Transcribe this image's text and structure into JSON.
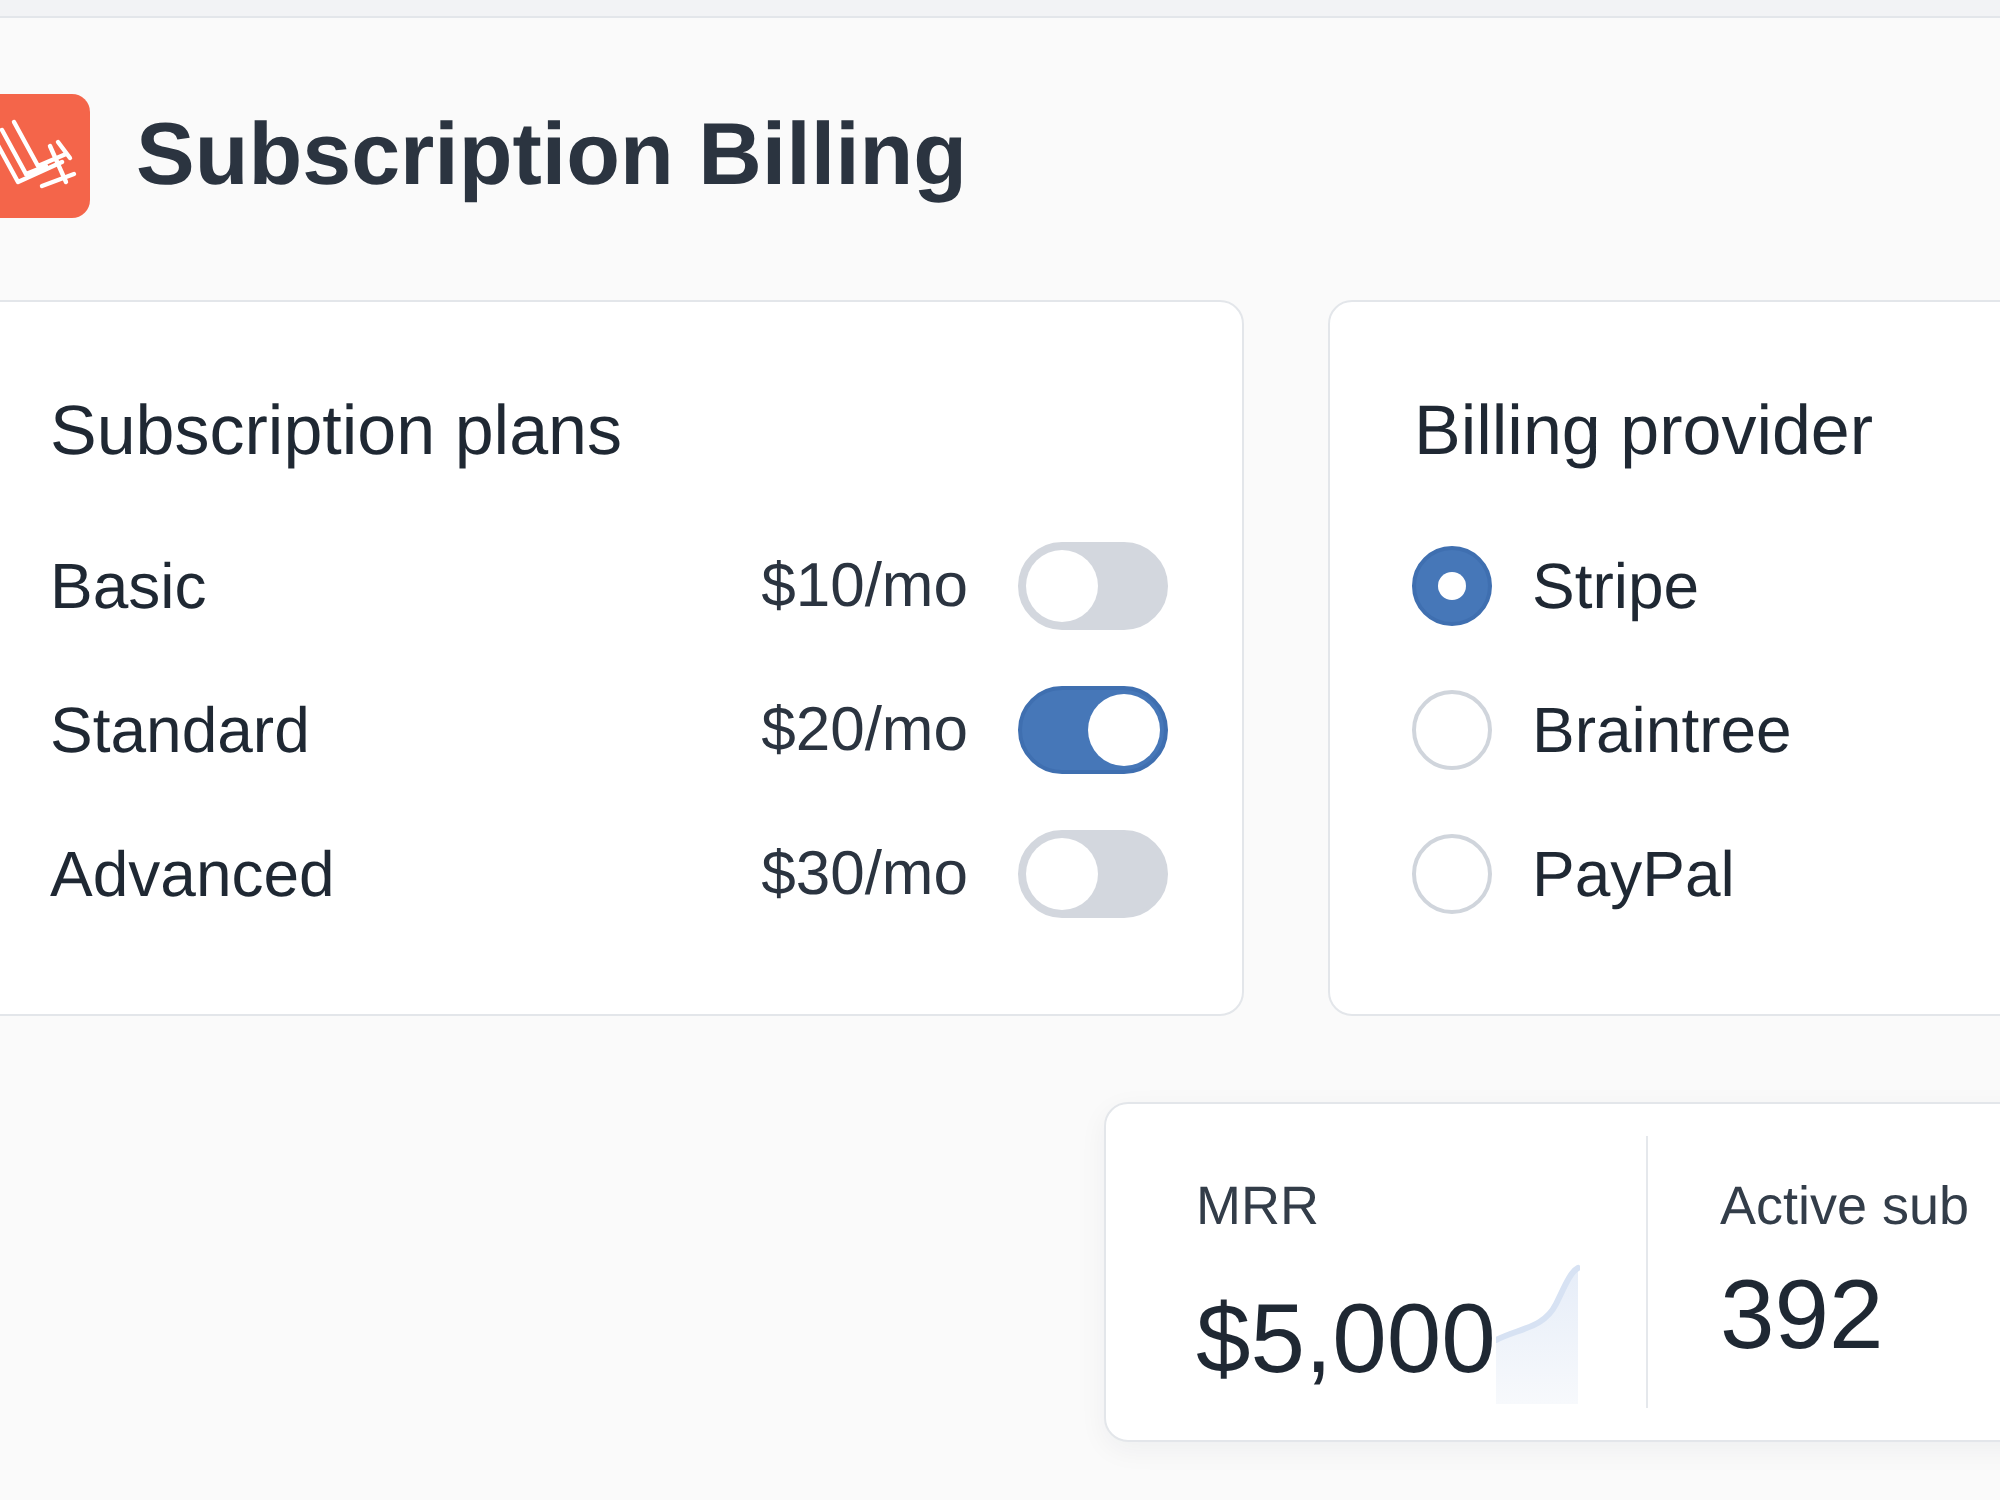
{
  "app": {
    "title": "Subscription Billing"
  },
  "plans_card": {
    "title": "Subscription plans",
    "plans": [
      {
        "name": "Basic",
        "price": "$10/mo",
        "on": false
      },
      {
        "name": "Standard",
        "price": "$20/mo",
        "on": true
      },
      {
        "name": "Advanced",
        "price": "$30/mo",
        "on": false
      }
    ]
  },
  "provider_card": {
    "title": "Billing provider",
    "providers": [
      {
        "name": "Stripe",
        "selected": true
      },
      {
        "name": "Braintree",
        "selected": false
      },
      {
        "name": "PayPal",
        "selected": false
      }
    ]
  },
  "metrics": [
    {
      "label": "MRR",
      "value": "$5,000",
      "kind": "trend"
    },
    {
      "label": "Active sub",
      "value": "392",
      "kind": "plain"
    }
  ]
}
